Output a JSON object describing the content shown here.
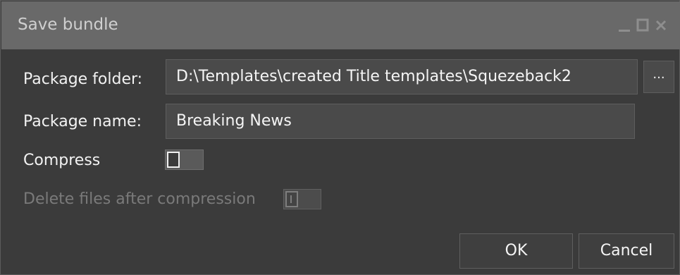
{
  "window": {
    "title": "Save bundle",
    "minimize_icon": "minimize-icon",
    "maximize_icon": "maximize-icon",
    "close_icon": "close-icon"
  },
  "form": {
    "package_folder_label": "Package folder:",
    "package_folder_value": "D:\\Templates\\created Title templates\\Squezeback2",
    "browse_label": "...",
    "package_name_label": "Package name:",
    "package_name_value": "Breaking News",
    "compress_label": "Compress",
    "compress_on": false,
    "delete_files_label": "Delete files after compression",
    "delete_files_on": false,
    "delete_files_enabled": false
  },
  "buttons": {
    "ok_label": "OK",
    "cancel_label": "Cancel"
  },
  "colors": {
    "background": "#3b3b3b",
    "titlebar": "#696969",
    "field": "#4a4a4a",
    "disabled_text": "#7a7a7a"
  }
}
